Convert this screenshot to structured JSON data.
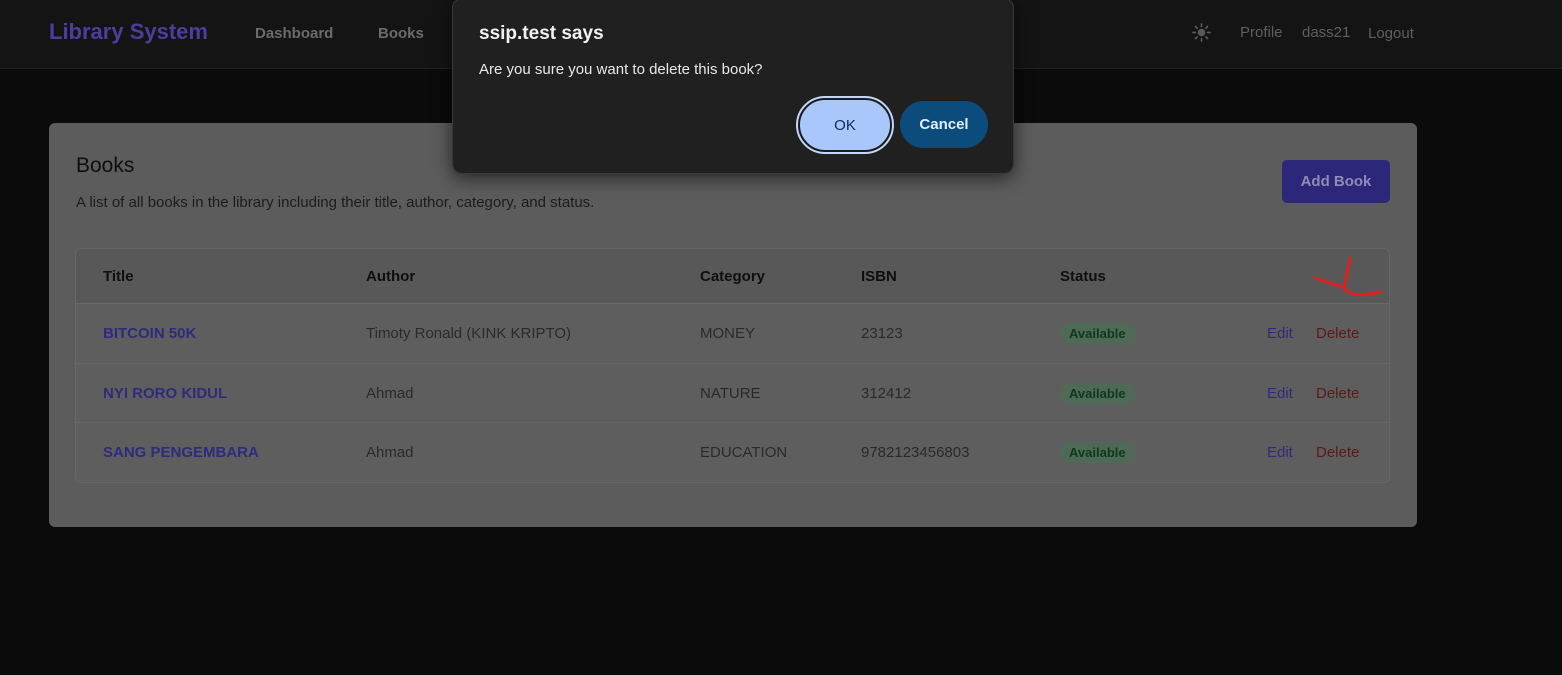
{
  "navbar": {
    "brand": "Library System",
    "links": [
      "Dashboard",
      "Books"
    ],
    "theme_icon": "sun-icon",
    "profile": "Profile",
    "username": "dass21",
    "logout": "Logout"
  },
  "page": {
    "title": "Books",
    "description": "A list of all books in the library including their title, author, category, and status.",
    "add_button": "Add Book"
  },
  "table": {
    "headers": [
      "Title",
      "Author",
      "Category",
      "ISBN",
      "Status"
    ],
    "rows": [
      {
        "title": "BITCOIN 50K",
        "author": "Timoty Ronald (KINK KRIPTO)",
        "category": "MONEY",
        "isbn": "23123",
        "status": "Available",
        "edit": "Edit",
        "delete": "Delete"
      },
      {
        "title": "NYI RORO KIDUL",
        "author": "Ahmad",
        "category": "NATURE",
        "isbn": "312412",
        "status": "Available",
        "edit": "Edit",
        "delete": "Delete"
      },
      {
        "title": "SANG PENGEMBARA",
        "author": "Ahmad",
        "category": "EDUCATION",
        "isbn": "9782123456803",
        "status": "Available",
        "edit": "Edit",
        "delete": "Delete"
      }
    ]
  },
  "dialog": {
    "title": "ssip.test says",
    "message": "Are you sure you want to delete this book?",
    "ok": "OK",
    "cancel": "Cancel"
  },
  "colors": {
    "brand": "#4a3f9e",
    "annotation": "#e02020",
    "ok_button": "#aac7fb",
    "cancel_button": "#0b4c7c"
  }
}
